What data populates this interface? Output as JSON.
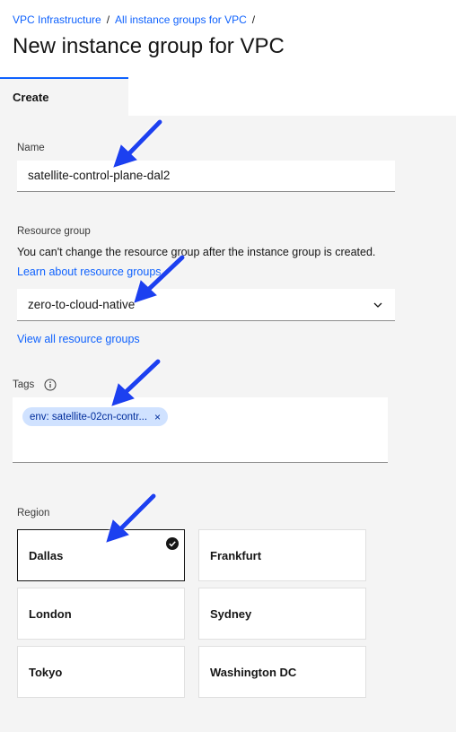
{
  "breadcrumb": {
    "items": [
      "VPC Infrastructure",
      "All instance groups for VPC"
    ],
    "separator": "/"
  },
  "page_title": "New instance group for VPC",
  "tabs": [
    {
      "label": "Create",
      "active": true
    }
  ],
  "form": {
    "name": {
      "label": "Name",
      "value": "satellite-control-plane-dal2"
    },
    "resource_group": {
      "label": "Resource group",
      "helper": "You can't change the resource group after the instance group is created.",
      "learn_link": "Learn about resource groups",
      "value": "zero-to-cloud-native",
      "view_all_link": "View all resource groups"
    },
    "tags": {
      "label": "Tags",
      "items": [
        "env: satellite-02cn-contr..."
      ],
      "remove_symbol": "×"
    },
    "region": {
      "label": "Region",
      "options": [
        "Dallas",
        "Frankfurt",
        "London",
        "Sydney",
        "Tokyo",
        "Washington DC"
      ],
      "selected": "Dallas"
    }
  },
  "colors": {
    "accent": "#0f62fe",
    "annotation_arrow": "#1a3ff0",
    "tag_bg": "#d0e2ff"
  },
  "icons": [
    "info-icon",
    "chevron-down-icon",
    "close-icon",
    "checkmark-icon",
    "annotation-arrow"
  ]
}
